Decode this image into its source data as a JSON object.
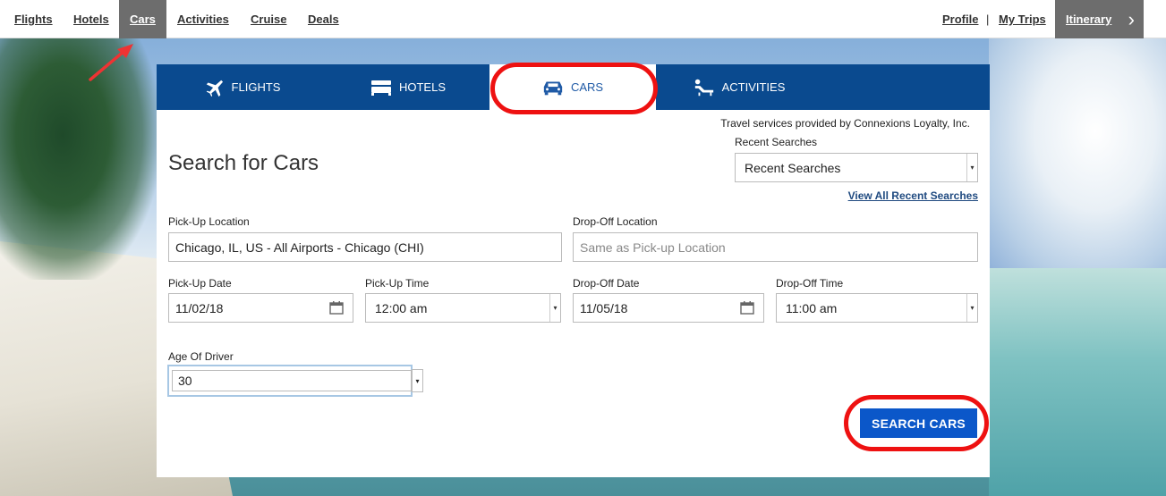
{
  "topnav": {
    "links": [
      "Flights",
      "Hotels",
      "Cars",
      "Activities",
      "Cruise",
      "Deals"
    ],
    "profile": "Profile",
    "separator": "|",
    "my_trips": "My Trips",
    "itinerary": "Itinerary",
    "itinerary_chevron": "›"
  },
  "tabs": [
    {
      "label": "FLIGHTS",
      "icon": "airplane-icon"
    },
    {
      "label": "HOTELS",
      "icon": "bed-icon"
    },
    {
      "label": "CARS",
      "icon": "car-icon"
    },
    {
      "label": "ACTIVITIES",
      "icon": "lounge-chair-icon"
    }
  ],
  "provider_text": "Travel services provided by Connexions Loyalty, Inc.",
  "title": "Search for Cars",
  "recent": {
    "label": "Recent Searches",
    "value": "Recent Searches",
    "view_all": "View All Recent Searches"
  },
  "pickup_location": {
    "label": "Pick-Up Location",
    "value": "Chicago, IL, US - All Airports - Chicago (CHI)"
  },
  "dropoff_location": {
    "label": "Drop-Off Location",
    "placeholder": "Same as Pick-up Location"
  },
  "pickup_date": {
    "label": "Pick-Up Date",
    "value": "11/02/18"
  },
  "pickup_time": {
    "label": "Pick-Up Time",
    "value": "12:00 am"
  },
  "dropoff_date": {
    "label": "Drop-Off Date",
    "value": "11/05/18"
  },
  "dropoff_time": {
    "label": "Drop-Off Time",
    "value": "11:00 am"
  },
  "driver_age": {
    "label": "Age Of Driver",
    "value": "30"
  },
  "search_button": "SEARCH CARS",
  "colors": {
    "tab_bar": "#0a4a8f",
    "active_tab_text": "#1f5aa6",
    "button": "#0b57c9",
    "highlight_ring": "#ee1111"
  }
}
